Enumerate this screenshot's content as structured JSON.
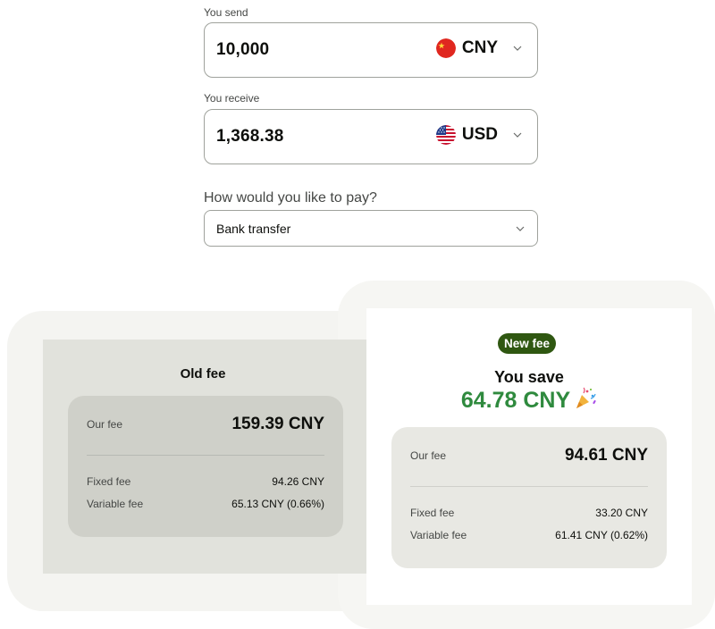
{
  "send": {
    "label": "You send",
    "amount": "10,000",
    "currency": "CNY",
    "flag": "china-flag-icon"
  },
  "receive": {
    "label": "You receive",
    "amount": "1,368.38",
    "currency": "USD",
    "flag": "us-flag-icon"
  },
  "payment": {
    "question": "How would you like to pay?",
    "selected": "Bank transfer"
  },
  "old_fee": {
    "title": "Old fee",
    "our_fee_label": "Our fee",
    "our_fee_value": "159.39 CNY",
    "fixed_label": "Fixed fee",
    "fixed_value": "94.26 CNY",
    "variable_label": "Variable fee",
    "variable_value": "65.13 CNY (0.66%)"
  },
  "new_fee": {
    "badge": "New fee",
    "save_title": "You save",
    "save_amount": "64.78 CNY",
    "our_fee_label": "Our fee",
    "our_fee_value": "94.61 CNY",
    "fixed_label": "Fixed fee",
    "fixed_value": "33.20 CNY",
    "variable_label": "Variable fee",
    "variable_value": "61.41 CNY (0.62%)"
  },
  "colors": {
    "badge_bg": "#2f5711",
    "savings_green": "#2f8a3e",
    "old_card_bg": "#e1e2dc"
  }
}
